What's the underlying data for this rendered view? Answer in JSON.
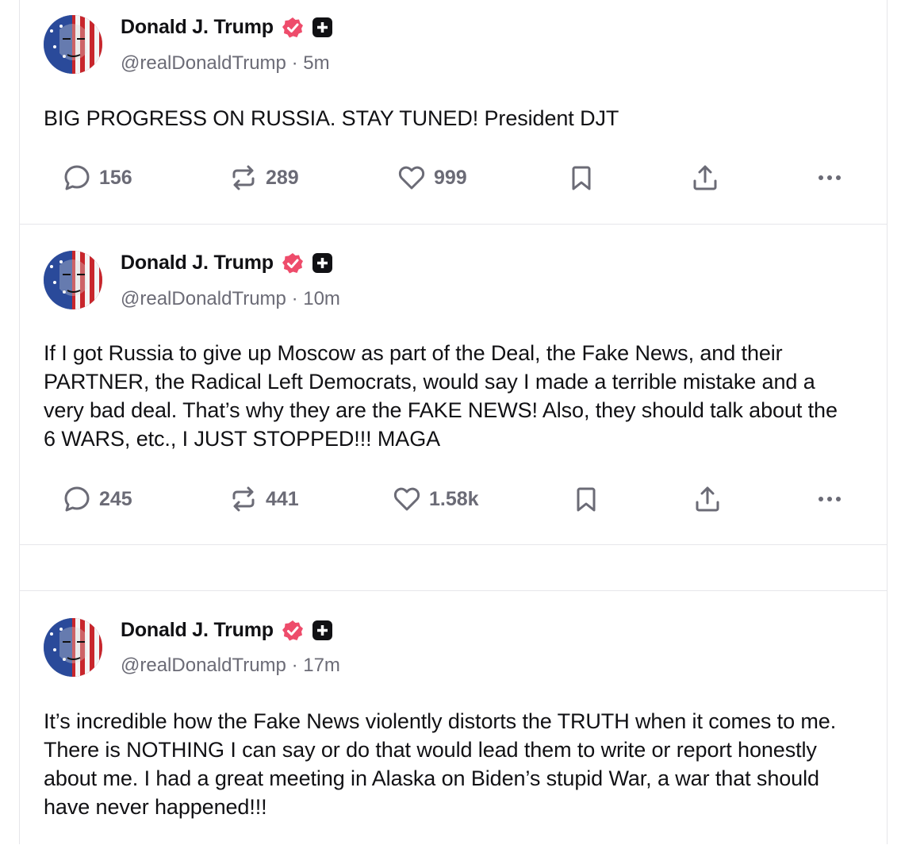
{
  "posts": [
    {
      "author": "Donald J. Trump",
      "handle": "@realDonaldTrump",
      "separator": "·",
      "time": "5m",
      "text": "BIG PROGRESS ON RUSSIA. STAY TUNED! President DJT",
      "replies": "156",
      "reposts": "289",
      "likes": "999"
    },
    {
      "author": "Donald J. Trump",
      "handle": "@realDonaldTrump",
      "separator": "·",
      "time": "10m",
      "text": "If I got Russia to give up Moscow as part of the Deal, the Fake News, and their PARTNER, the Radical Left Democrats, would say I made a terrible mistake and a very bad deal. That’s why they are the FAKE NEWS! Also, they should talk about the 6 WARS, etc., I JUST STOPPED!!! MAGA",
      "replies": "245",
      "reposts": "441",
      "likes": "1.58k"
    },
    {
      "author": "Donald J. Trump",
      "handle": "@realDonaldTrump",
      "separator": "·",
      "time": "17m",
      "text": "It’s incredible how the Fake News violently distorts the TRUTH when it comes to me. There is NOTHING I can say or do that would lead them to write or report honestly about me. I had a great meeting in Alaska on Biden’s stupid War, a war that should have never happened!!!"
    }
  ],
  "icons": {
    "verified": "verified-badge-icon",
    "plus": "plus-badge-icon",
    "reply": "reply-bubble-icon",
    "repost": "repost-icon",
    "like": "heart-icon",
    "bookmark": "bookmark-icon",
    "share": "share-upload-icon",
    "more": "more-dots-icon"
  },
  "colors": {
    "verified": "#ee4c6b",
    "text": "#111114",
    "muted": "#6b6b76",
    "divider": "#e6e6ea"
  }
}
